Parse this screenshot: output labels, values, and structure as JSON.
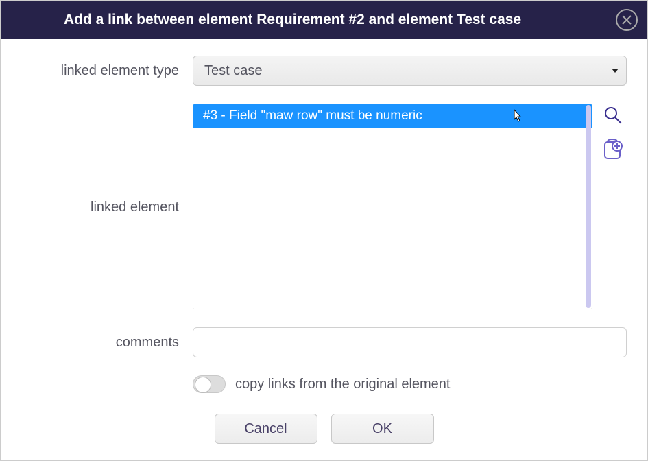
{
  "title": "Add a link between element Requirement #2 and element Test case",
  "labels": {
    "linked_element_type": "linked element type",
    "linked_element": "linked element",
    "comments": "comments",
    "copy_links": "copy links from the original element"
  },
  "fields": {
    "type_selected": "Test case",
    "list_items": [
      "#3 - Field \"maw row\" must be numeric"
    ],
    "comments_value": ""
  },
  "buttons": {
    "cancel": "Cancel",
    "ok": "OK"
  }
}
